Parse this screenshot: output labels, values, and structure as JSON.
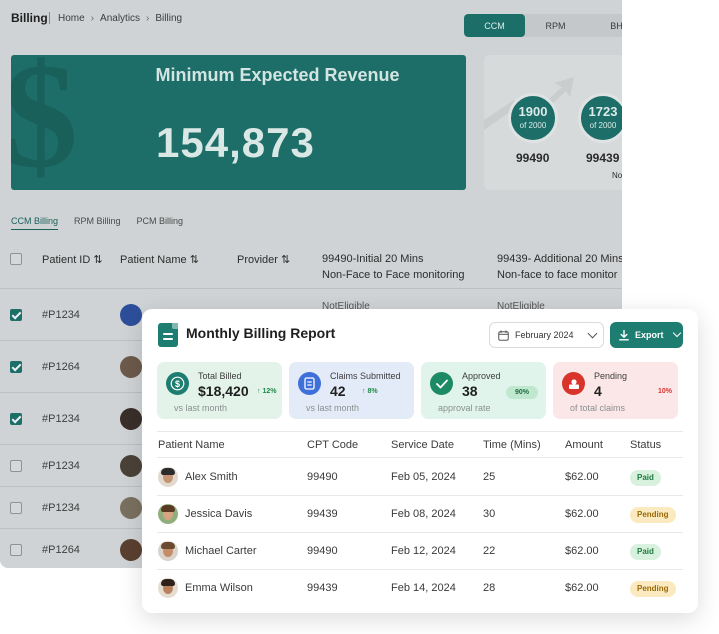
{
  "header": {
    "title": "Billing",
    "breadcrumbs": [
      "Home",
      "Analytics",
      "Billing"
    ],
    "segments": [
      "CCM",
      "RPM",
      "BH"
    ],
    "active_segment": "CCM"
  },
  "hero": {
    "title": "Minimum Expected Revenue",
    "value": "154,873",
    "symbol": "$"
  },
  "kpis": [
    {
      "count": "1900",
      "of": "of 2000",
      "code": "99490"
    },
    {
      "count": "1723",
      "of": "of 2000",
      "code": "99439"
    }
  ],
  "kpi_note": "No",
  "subtabs": [
    "CCM Billing",
    "RPM Billing",
    "PCM Billing"
  ],
  "bg_table": {
    "headers": {
      "patient_id": "Patient ID ⇅",
      "patient_name": "Patient Name ⇅",
      "provider": "Provider ⇅",
      "col_99490_line1": "99490-Initial 20 Mins",
      "col_99490_line2": "Non-Face to Face monitoring",
      "col_99439_line1": "99439- Additional 20 Mins",
      "col_99439_line2": "Non-face to face monitor"
    },
    "not_eligible": "NotEligible",
    "rows": [
      {
        "id": "#P1234",
        "checked": true
      },
      {
        "id": "#P1264",
        "checked": true
      },
      {
        "id": "#P1234",
        "checked": true
      },
      {
        "id": "#P1234",
        "checked": false
      },
      {
        "id": "#P1234",
        "checked": false
      },
      {
        "id": "#P1264",
        "checked": false
      }
    ]
  },
  "report": {
    "title": "Monthly Billing Report",
    "month": "February 2024",
    "export_label": "Export",
    "cards": [
      {
        "label": "Total Billed",
        "value": "$18,420",
        "change": "↑ 12%",
        "sub": "vs last month",
        "icon": "dollar-icon",
        "bg": "#e3f3ea",
        "icon_bg": "#1d7d70",
        "change_color": "#1e8a48"
      },
      {
        "label": "Claims Submitted",
        "value": "42",
        "change": "↑ 8%",
        "sub": "vs last month",
        "icon": "document-icon",
        "bg": "#e4ebf8",
        "icon_bg": "#3f6fd8",
        "change_color": "#1e8a48"
      },
      {
        "label": "Approved",
        "value": "38",
        "change": "90%",
        "sub": "approval rate",
        "icon": "check-icon",
        "bg": "#e0f4ec",
        "icon_bg": "#1d8a66",
        "change_color": "#1e6b3e"
      },
      {
        "label": "Pending",
        "value": "4",
        "change": "10%",
        "sub": "of total claims",
        "icon": "alert-icon",
        "bg": "#fbe7e7",
        "icon_bg": "#d9342b",
        "change_color": "#d9342b"
      }
    ],
    "columns": [
      "Patient Name",
      "CPT Code",
      "Service Date",
      "Time (Mins)",
      "Amount",
      "Status"
    ],
    "rows": [
      {
        "name": "Alex Smith",
        "cpt": "99490",
        "date": "Feb 05, 2024",
        "time": "25",
        "amount": "$62.00",
        "status": "Paid"
      },
      {
        "name": "Jessica Davis",
        "cpt": "99439",
        "date": "Feb 08, 2024",
        "time": "30",
        "amount": "$62.00",
        "status": "Pending"
      },
      {
        "name": "Michael Carter",
        "cpt": "99490",
        "date": "Feb 12, 2024",
        "time": "22",
        "amount": "$62.00",
        "status": "Paid"
      },
      {
        "name": "Emma Wilson",
        "cpt": "99439",
        "date": "Feb 14, 2024",
        "time": "28",
        "amount": "$62.00",
        "status": "Pending"
      }
    ]
  }
}
